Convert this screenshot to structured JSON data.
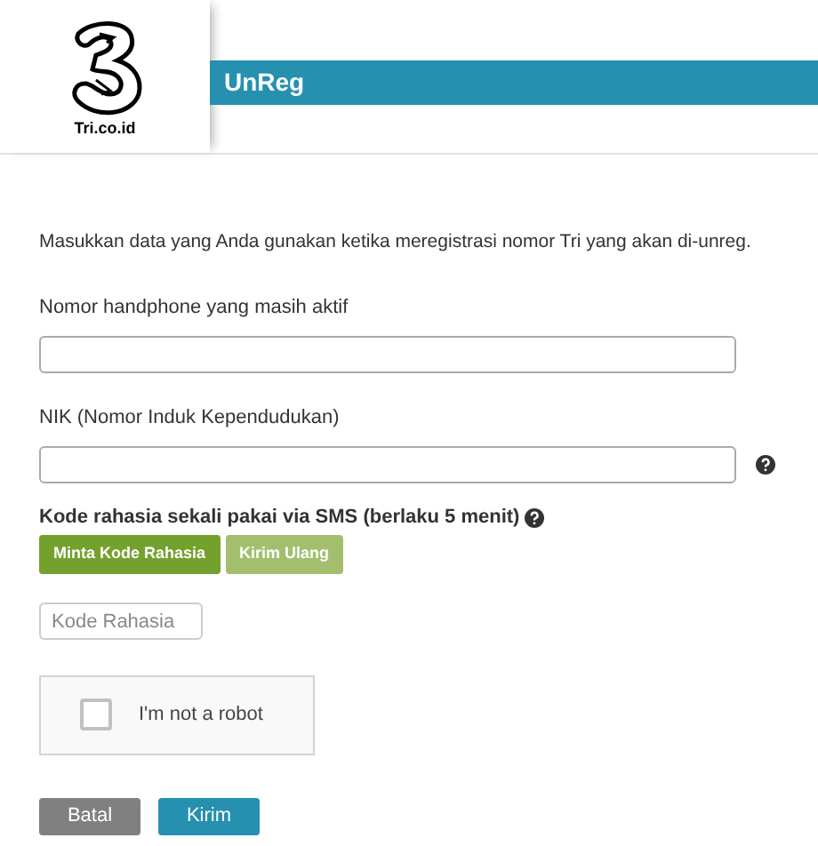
{
  "header": {
    "logo_caption": "Tri.co.id",
    "title": "UnReg"
  },
  "intro": "Masukkan data yang Anda gunakan ketika meregistrasi nomor Tri yang akan di-unreg.",
  "fields": [
    {
      "label": "Nomor handphone yang masih aktif",
      "help": false
    },
    {
      "label": "NIK (Nomor Induk Kependudukan)",
      "help": true
    }
  ],
  "otp": {
    "label": "Kode rahasia sekali pakai via SMS (berlaku 5 menit)",
    "buttons": [
      {
        "label": "Minta Kode Rahasia",
        "disabled": false
      },
      {
        "label": "Kirim Ulang",
        "disabled": true
      }
    ],
    "placeholder": "Kode Rahasia"
  },
  "captcha": {
    "label": "I'm not a robot",
    "checked": false
  },
  "actions": [
    {
      "label": "Batal",
      "kind": "cancel"
    },
    {
      "label": "Kirim",
      "kind": "submit"
    }
  ]
}
